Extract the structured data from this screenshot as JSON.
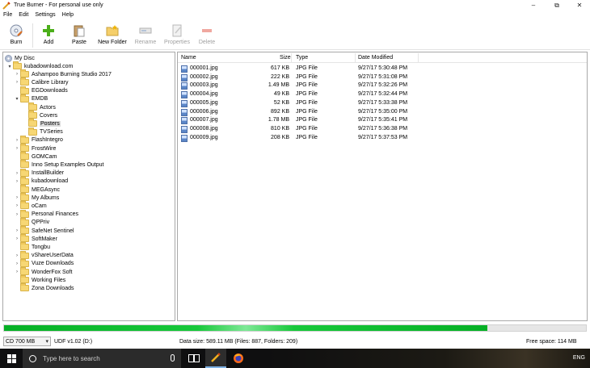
{
  "window": {
    "title": "True Burner - For personal use only",
    "controls": {
      "minimize": "–",
      "maximize": "⧉",
      "close": "✕"
    }
  },
  "menu": [
    "File",
    "Edit",
    "Settings",
    "Help"
  ],
  "toolbar": {
    "items": [
      {
        "label": "Burn",
        "icon": "burn-disc-icon",
        "enabled": true
      },
      {
        "label": "Add",
        "icon": "add-plus-icon",
        "enabled": true
      },
      {
        "label": "Paste",
        "icon": "paste-clipboard-icon",
        "enabled": true
      },
      {
        "label": "New Folder",
        "icon": "new-folder-icon",
        "enabled": true
      },
      {
        "label": "Rename",
        "icon": "rename-icon",
        "enabled": false
      },
      {
        "label": "Properties",
        "icon": "properties-icon",
        "enabled": false
      },
      {
        "label": "Delete",
        "icon": "delete-icon",
        "enabled": false
      }
    ]
  },
  "tree": {
    "root": "My Disc",
    "items": [
      {
        "label": "kubadownload.com",
        "level": 1,
        "expander": "▾"
      },
      {
        "label": "Ashampoo Burning Studio 2017",
        "level": 2,
        "expander": "›"
      },
      {
        "label": "Calibre Library",
        "level": 2,
        "expander": "›"
      },
      {
        "label": "EGDownloads",
        "level": 2,
        "expander": ""
      },
      {
        "label": "EMDB",
        "level": 2,
        "expander": "▾"
      },
      {
        "label": "Actors",
        "level": 3,
        "expander": ""
      },
      {
        "label": "Covers",
        "level": 3,
        "expander": ""
      },
      {
        "label": "Posters",
        "level": 3,
        "expander": "",
        "selected": true
      },
      {
        "label": "TVSeries",
        "level": 3,
        "expander": ""
      },
      {
        "label": "FlashIntegro",
        "level": 2,
        "expander": "›"
      },
      {
        "label": "FrostWire",
        "level": 2,
        "expander": "›"
      },
      {
        "label": "GOMCam",
        "level": 2,
        "expander": ""
      },
      {
        "label": "Inno Setup Examples Output",
        "level": 2,
        "expander": ""
      },
      {
        "label": "InstallBuilder",
        "level": 2,
        "expander": "›"
      },
      {
        "label": "kubadownload",
        "level": 2,
        "expander": "›"
      },
      {
        "label": "MEGAsync",
        "level": 2,
        "expander": ""
      },
      {
        "label": "My Albums",
        "level": 2,
        "expander": "›"
      },
      {
        "label": "oCam",
        "level": 2,
        "expander": "›"
      },
      {
        "label": "Personal Finances",
        "level": 2,
        "expander": "›"
      },
      {
        "label": "QPPriv",
        "level": 2,
        "expander": ""
      },
      {
        "label": "SafeNet Sentinel",
        "level": 2,
        "expander": "›"
      },
      {
        "label": "SoftMaker",
        "level": 2,
        "expander": "›"
      },
      {
        "label": "Tongbu",
        "level": 2,
        "expander": ""
      },
      {
        "label": "vShareUserData",
        "level": 2,
        "expander": "›"
      },
      {
        "label": "Vuze Downloads",
        "level": 2,
        "expander": "›"
      },
      {
        "label": "WonderFox Soft",
        "level": 2,
        "expander": "›"
      },
      {
        "label": "Working Files",
        "level": 2,
        "expander": ""
      },
      {
        "label": "Zona Downloads",
        "level": 2,
        "expander": ""
      }
    ]
  },
  "files": {
    "columns": [
      "Name",
      "Size",
      "Type",
      "Date Modified"
    ],
    "rows": [
      {
        "name": "000001.jpg",
        "size": "617 KB",
        "type": "JPG File",
        "date": "9/27/17 5:30:48 PM"
      },
      {
        "name": "000002.jpg",
        "size": "222 KB",
        "type": "JPG File",
        "date": "9/27/17 5:31:08 PM"
      },
      {
        "name": "000003.jpg",
        "size": "1.49 MB",
        "type": "JPG File",
        "date": "9/27/17 5:32:26 PM"
      },
      {
        "name": "000004.jpg",
        "size": "49 KB",
        "type": "JPG File",
        "date": "9/27/17 5:32:44 PM"
      },
      {
        "name": "000005.jpg",
        "size": "52 KB",
        "type": "JPG File",
        "date": "9/27/17 5:33:38 PM"
      },
      {
        "name": "000006.jpg",
        "size": "892 KB",
        "type": "JPG File",
        "date": "9/27/17 5:35:00 PM"
      },
      {
        "name": "000007.jpg",
        "size": "1.78 MB",
        "type": "JPG File",
        "date": "9/27/17 5:35:41 PM"
      },
      {
        "name": "000008.jpg",
        "size": "810 KB",
        "type": "JPG File",
        "date": "9/27/17 5:36:38 PM"
      },
      {
        "name": "000009.jpg",
        "size": "208 KB",
        "type": "JPG File",
        "date": "9/27/17 5:37:53 PM"
      }
    ]
  },
  "capacity": {
    "fill_fraction": 0.83,
    "color": "#06b025"
  },
  "status": {
    "disk_type": "CD 700 MB",
    "disk_arrow": "▾",
    "format": "UDF v1.02 (D:)",
    "data_size": "Data size: 589.11 MB (Files: 887, Folders: 209)",
    "free_space": "Free space: 114 MB"
  },
  "taskbar": {
    "search_placeholder": "Type here to search",
    "language": "ENG"
  }
}
